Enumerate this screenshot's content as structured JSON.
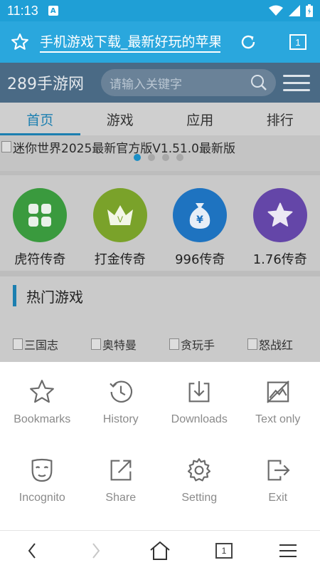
{
  "status_bar": {
    "time": "11:13",
    "notification_icon": "A"
  },
  "address_bar": {
    "url_text": "手机游戏下载_最新好玩的苹果",
    "tab_count": "1"
  },
  "page": {
    "site_title": "289手游网",
    "search_placeholder": "请输入关键字",
    "nav": [
      "首页",
      "游戏",
      "应用",
      "排行"
    ],
    "banner_text": "迷你世界2025最新官方版V1.51.0最新版",
    "quick_links": [
      {
        "label": "虎符传奇",
        "color": "#3a9a3e",
        "icon": "grid-icon"
      },
      {
        "label": "打金传奇",
        "color": "#7aa22a",
        "icon": "crown-icon"
      },
      {
        "label": "996传奇",
        "color": "#1e73c0",
        "icon": "money-bag-icon"
      },
      {
        "label": "1.76传奇",
        "color": "#6446a8",
        "icon": "star-icon"
      }
    ],
    "hot_title": "热门游戏",
    "hot_games": [
      "三国志",
      "奥特曼",
      "贪玩手",
      "怒战红"
    ]
  },
  "menu": {
    "items": [
      {
        "label": "Bookmarks",
        "icon": "star-outline-icon"
      },
      {
        "label": "History",
        "icon": "history-icon"
      },
      {
        "label": "Downloads",
        "icon": "download-icon"
      },
      {
        "label": "Text only",
        "icon": "no-image-icon"
      },
      {
        "label": "Incognito",
        "icon": "mask-icon"
      },
      {
        "label": "Share",
        "icon": "share-icon"
      },
      {
        "label": "Setting",
        "icon": "gear-icon"
      },
      {
        "label": "Exit",
        "icon": "exit-icon"
      }
    ]
  },
  "bottom_bar": {
    "tab_count": "1"
  },
  "colors": {
    "accent": "#2aa7dd",
    "status_bar": "#1f9fd6",
    "nav_active": "#1c7fb0",
    "menu_icon": "#6b6b6b"
  }
}
